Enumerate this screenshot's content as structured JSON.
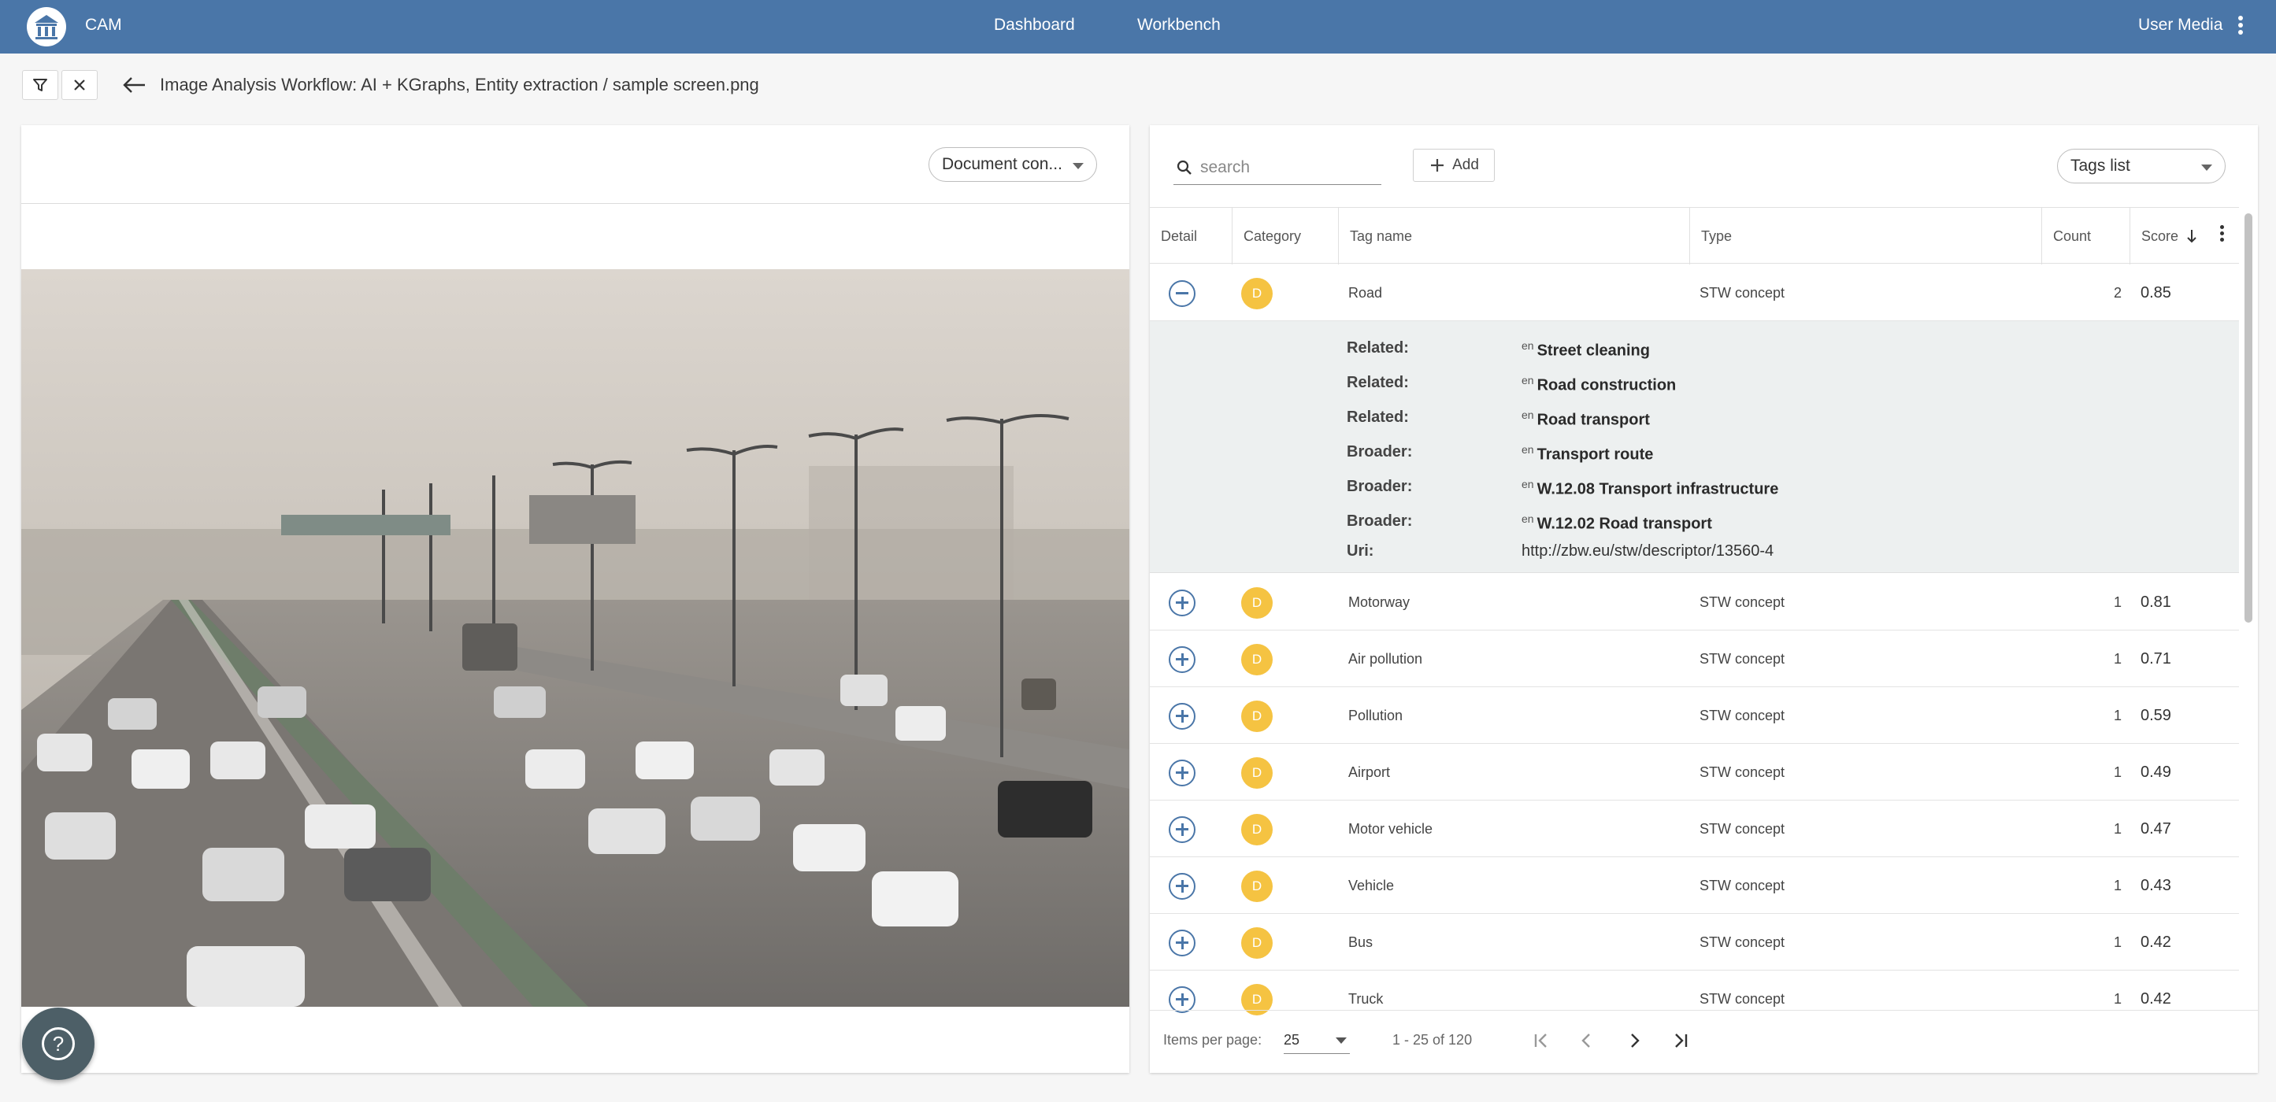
{
  "topbar": {
    "app_name": "CAM",
    "nav": [
      "Dashboard",
      "Workbench"
    ],
    "user_menu": "User Media"
  },
  "breadcrumb": {
    "path": "Image Analysis Workflow: AI + KGraphs, Entity extraction / sample screen.png"
  },
  "left_panel": {
    "view_select": "Document con..."
  },
  "right_panel": {
    "search_placeholder": "search",
    "add_label": "Add",
    "list_select": "Tags list",
    "columns": [
      "Detail",
      "Category",
      "Tag name",
      "Type",
      "Count",
      "Score"
    ],
    "expanded_row": {
      "category": "D",
      "tag_name": "Road",
      "type": "STW concept",
      "count": "2",
      "score": "0.85",
      "details": [
        {
          "key": "Related:",
          "lang": "en",
          "value": "Street cleaning"
        },
        {
          "key": "Related:",
          "lang": "en",
          "value": "Road construction"
        },
        {
          "key": "Related:",
          "lang": "en",
          "value": "Road transport"
        },
        {
          "key": "Broader:",
          "lang": "en",
          "value": "Transport route"
        },
        {
          "key": "Broader:",
          "lang": "en",
          "value": "W.12.08 Transport infrastructure"
        },
        {
          "key": "Broader:",
          "lang": "en",
          "value": "W.12.02 Road transport"
        }
      ],
      "uri_label": "Uri:",
      "uri_value": "http://zbw.eu/stw/descriptor/13560-4"
    },
    "rows": [
      {
        "category": "D",
        "tag_name": "Motorway",
        "type": "STW concept",
        "count": "1",
        "score": "0.81"
      },
      {
        "category": "D",
        "tag_name": "Air pollution",
        "type": "STW concept",
        "count": "1",
        "score": "0.71"
      },
      {
        "category": "D",
        "tag_name": "Pollution",
        "type": "STW concept",
        "count": "1",
        "score": "0.59"
      },
      {
        "category": "D",
        "tag_name": "Airport",
        "type": "STW concept",
        "count": "1",
        "score": "0.49"
      },
      {
        "category": "D",
        "tag_name": "Motor vehicle",
        "type": "STW concept",
        "count": "1",
        "score": "0.47"
      },
      {
        "category": "D",
        "tag_name": "Vehicle",
        "type": "STW concept",
        "count": "1",
        "score": "0.43"
      },
      {
        "category": "D",
        "tag_name": "Bus",
        "type": "STW concept",
        "count": "1",
        "score": "0.42"
      },
      {
        "category": "D",
        "tag_name": "Truck",
        "type": "STW concept",
        "count": "1",
        "score": "0.42"
      }
    ],
    "pager": {
      "items_per_page_label": "Items per page:",
      "items_per_page": "25",
      "range": "1 - 25 of 120"
    }
  },
  "colors": {
    "topbar": "#4a76a8",
    "accent": "#4a76a8",
    "category_badge": "#f5c342",
    "help_button": "#4d5f67"
  },
  "icons": {
    "logo": "museum-building-icon",
    "filter": "filter-icon",
    "close": "close-icon",
    "back": "arrow-left-icon",
    "search": "search-icon",
    "add": "plus-icon",
    "sort": "arrow-down-icon",
    "expand": "plus-circle-icon",
    "collapse": "minus-circle-icon",
    "help": "question-circle-icon"
  }
}
